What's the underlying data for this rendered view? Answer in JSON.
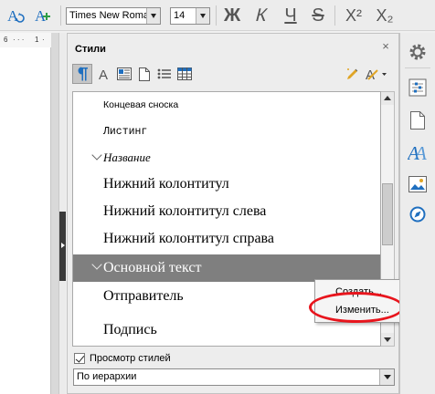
{
  "toolbar": {
    "font_name": "Times New Roman",
    "font_size": "14",
    "bold": "Ж",
    "italic": "К",
    "underline": "Ч",
    "strikethrough": "S",
    "superscript": "X²",
    "subscript": "X₂"
  },
  "ruler": {
    "marks": [
      "6",
      "1"
    ]
  },
  "panel": {
    "title": "Стили",
    "close": "×",
    "items": [
      {
        "label": "Концевая сноска",
        "expandable": false,
        "selected": false
      },
      {
        "label": "Листинг",
        "expandable": false,
        "selected": false
      },
      {
        "label": "Название",
        "expandable": true,
        "selected": false
      },
      {
        "label": "Нижний колонтитул",
        "expandable": false,
        "selected": false
      },
      {
        "label": "Нижний колонтитул слева",
        "expandable": false,
        "selected": false
      },
      {
        "label": "Нижний колонтитул справа",
        "expandable": false,
        "selected": false
      },
      {
        "label": "Основной текст",
        "expandable": true,
        "selected": true
      },
      {
        "label": "Отправитель",
        "expandable": false,
        "selected": false
      },
      {
        "label": "Подпись",
        "expandable": false,
        "selected": false
      }
    ],
    "preview_label": "Просмотр стилей",
    "preview_checked": true,
    "filter_value": "По иерархии"
  },
  "context_menu": {
    "items": [
      "Создать...",
      "Изменить..."
    ],
    "highlighted_item": "Изменить..."
  },
  "colors": {
    "selection": "#7f7f7f",
    "highlight_ellipse": "#e8151d",
    "accent_blue": "#1f6fbf",
    "accent_green": "#2e9e45"
  }
}
